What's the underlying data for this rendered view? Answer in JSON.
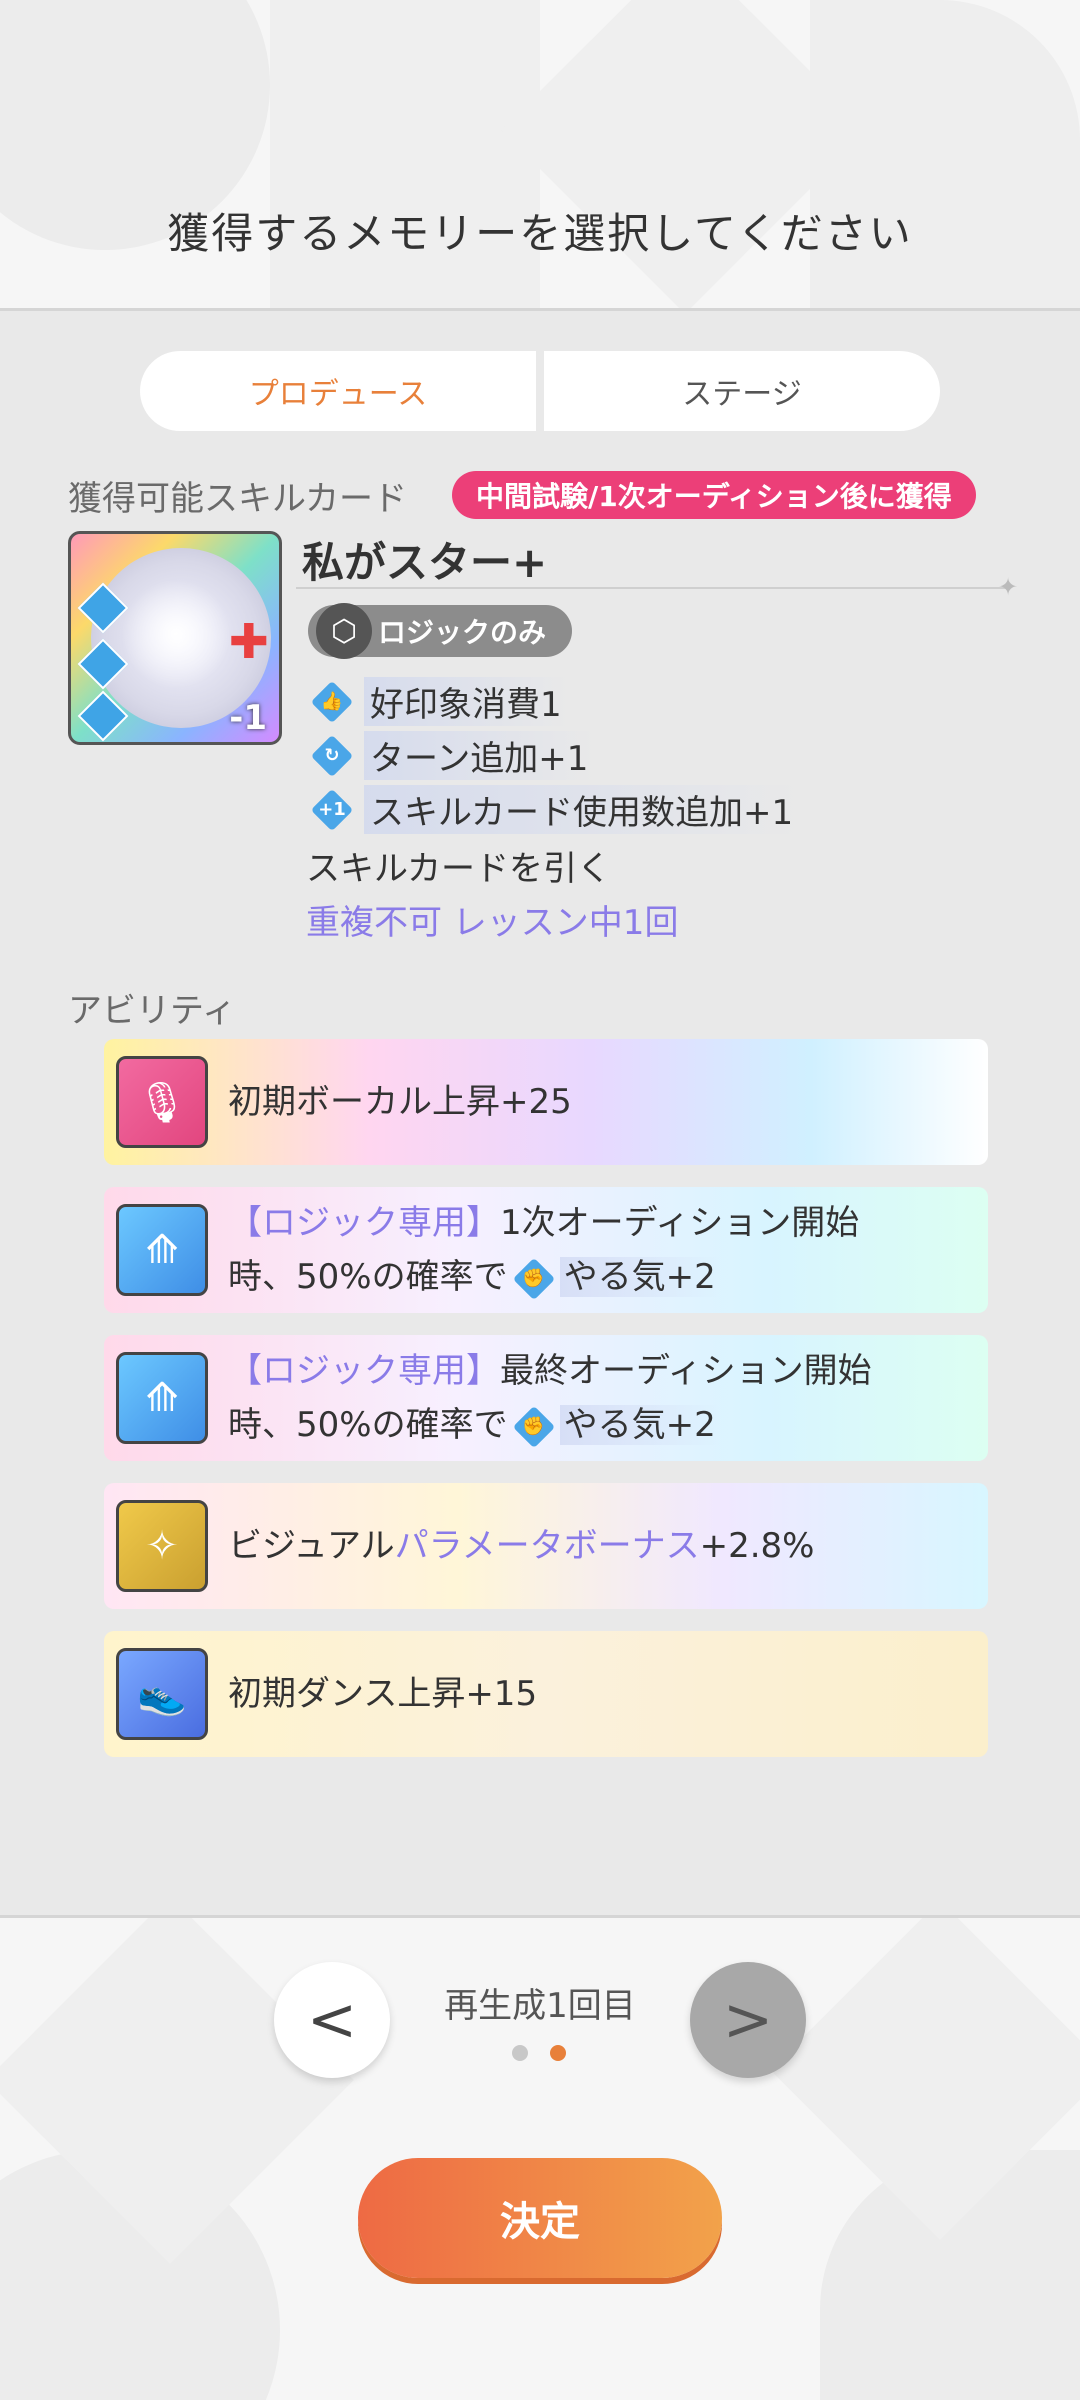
{
  "header": {
    "title": "獲得するメモリーを選択してください"
  },
  "tabs": [
    {
      "label": "プロデュース",
      "active": true
    },
    {
      "label": "ステージ",
      "active": false
    }
  ],
  "skill_section": {
    "label": "獲得可能スキルカード",
    "badge": "中間試験/1次オーディション後に獲得",
    "card_name": "私がスター+",
    "card_image_badge": "-1",
    "logic_badge": "ロジックのみ",
    "effects": [
      {
        "icon": "thumb-up-icon",
        "text": "好印象消費1"
      },
      {
        "icon": "turn-add-icon",
        "text": "ターン追加+1"
      },
      {
        "icon": "plus-one-icon",
        "text": "スキルカード使用数追加+1"
      }
    ],
    "draw_text": "スキルカードを引く",
    "limit_text": "重複不可 レッスン中1回"
  },
  "ability_section": {
    "label": "アビリティ",
    "items": [
      {
        "icon": "microphone-icon",
        "text": "初期ボーカル上昇+25"
      },
      {
        "icon": "logic-chevron-icon",
        "tag": "【ロジック専用】",
        "text1": "1次オーディション開始",
        "text2": "時、50%の確率で",
        "effect": "やる気+2"
      },
      {
        "icon": "logic-chevron-icon",
        "tag": "【ロジック専用】",
        "text1": "最終オーディション開始",
        "text2": "時、50%の確率で",
        "effect": "やる気+2"
      },
      {
        "prefix": "ビジュアル",
        "highlight": "パラメータボーナス",
        "suffix": "+2.8%",
        "icon": "visual-icon"
      },
      {
        "icon": "dance-icon",
        "text": "初期ダンス上昇+15"
      }
    ]
  },
  "footer": {
    "regen_label": "再生成1回目",
    "prev_label": "<",
    "next_label": ">",
    "pages": 2,
    "current_page": 2,
    "decide_label": "決定"
  },
  "colors": {
    "accent": "#e8803a",
    "badge": "#ec3f78",
    "purple": "#8a7be8"
  }
}
